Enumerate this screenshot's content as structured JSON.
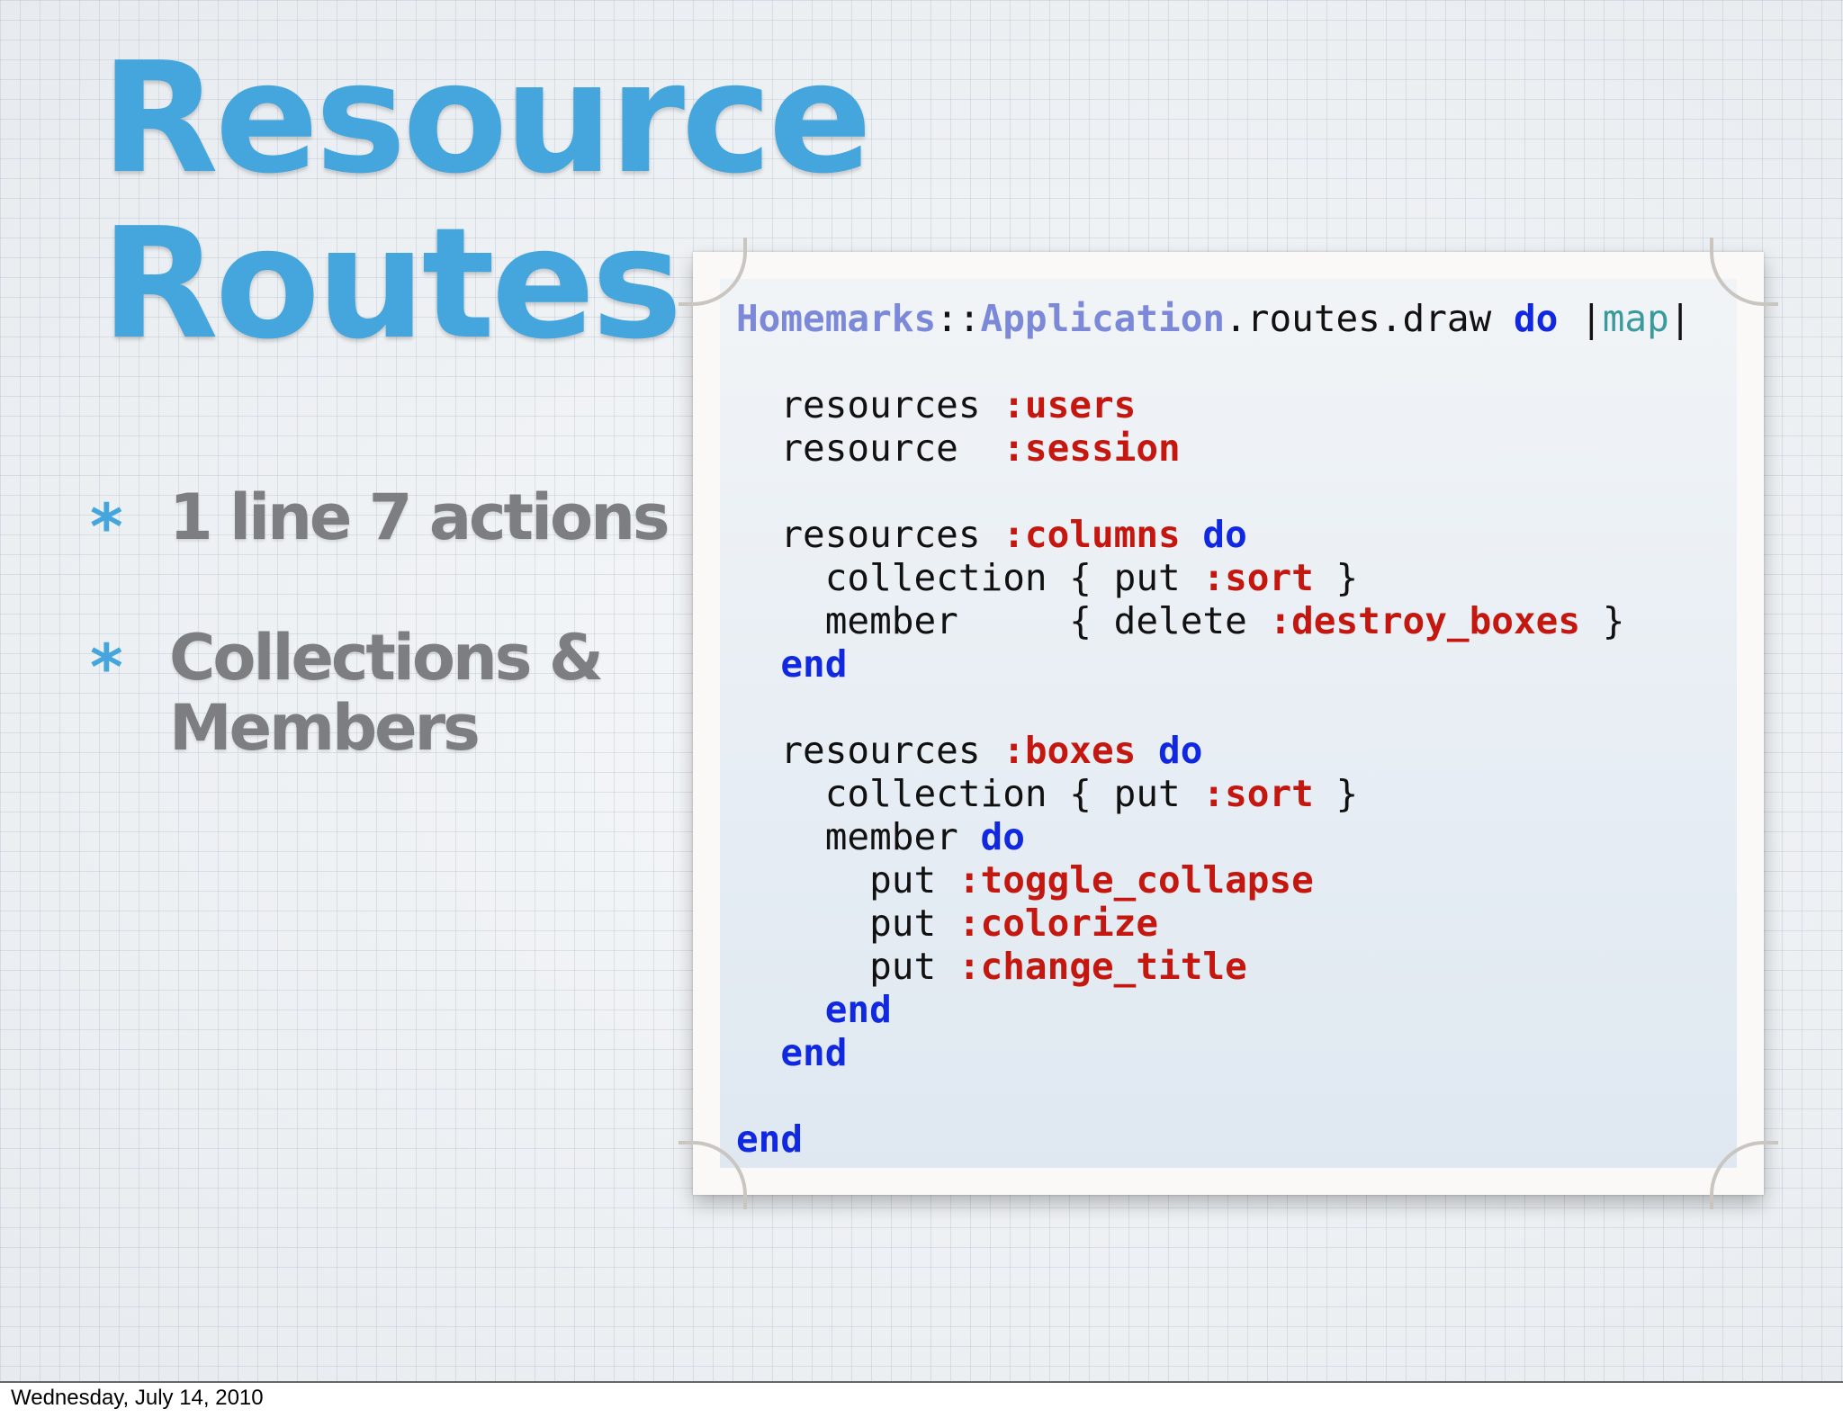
{
  "slide": {
    "title_lines": [
      "Resource",
      "Routes"
    ],
    "bullets": [
      {
        "marker": "*",
        "lines": [
          "1 line 7 actions"
        ]
      },
      {
        "marker": "*",
        "lines": [
          "Collections &",
          "Members"
        ]
      }
    ],
    "code": {
      "lines": [
        {
          "indent": 0,
          "tokens": [
            {
              "t": "class",
              "v": "Homemarks"
            },
            {
              "t": "plain",
              "v": "::"
            },
            {
              "t": "class",
              "v": "Application"
            },
            {
              "t": "plain",
              "v": ".routes.draw "
            },
            {
              "t": "kw",
              "v": "do"
            },
            {
              "t": "plain",
              "v": " |"
            },
            {
              "t": "var",
              "v": "map"
            },
            {
              "t": "plain",
              "v": "|"
            }
          ]
        },
        {
          "indent": 0,
          "tokens": []
        },
        {
          "indent": 1,
          "tokens": [
            {
              "t": "plain",
              "v": "resources "
            },
            {
              "t": "sym",
              "v": ":users"
            }
          ]
        },
        {
          "indent": 1,
          "tokens": [
            {
              "t": "plain",
              "v": "resource  "
            },
            {
              "t": "sym",
              "v": ":session"
            }
          ]
        },
        {
          "indent": 0,
          "tokens": []
        },
        {
          "indent": 1,
          "tokens": [
            {
              "t": "plain",
              "v": "resources "
            },
            {
              "t": "sym",
              "v": ":columns"
            },
            {
              "t": "plain",
              "v": " "
            },
            {
              "t": "kw",
              "v": "do"
            }
          ]
        },
        {
          "indent": 2,
          "tokens": [
            {
              "t": "plain",
              "v": "collection { put "
            },
            {
              "t": "sym",
              "v": ":sort"
            },
            {
              "t": "plain",
              "v": " }"
            }
          ]
        },
        {
          "indent": 2,
          "tokens": [
            {
              "t": "plain",
              "v": "member     { delete "
            },
            {
              "t": "sym",
              "v": ":destroy_boxes"
            },
            {
              "t": "plain",
              "v": " }"
            }
          ]
        },
        {
          "indent": 1,
          "tokens": [
            {
              "t": "kw",
              "v": "end"
            }
          ]
        },
        {
          "indent": 0,
          "tokens": []
        },
        {
          "indent": 1,
          "tokens": [
            {
              "t": "plain",
              "v": "resources "
            },
            {
              "t": "sym",
              "v": ":boxes"
            },
            {
              "t": "plain",
              "v": " "
            },
            {
              "t": "kw",
              "v": "do"
            }
          ]
        },
        {
          "indent": 2,
          "tokens": [
            {
              "t": "plain",
              "v": "collection { put "
            },
            {
              "t": "sym",
              "v": ":sort"
            },
            {
              "t": "plain",
              "v": " }"
            }
          ]
        },
        {
          "indent": 2,
          "tokens": [
            {
              "t": "plain",
              "v": "member "
            },
            {
              "t": "kw",
              "v": "do"
            }
          ]
        },
        {
          "indent": 3,
          "tokens": [
            {
              "t": "plain",
              "v": "put "
            },
            {
              "t": "sym",
              "v": ":toggle_collapse"
            }
          ]
        },
        {
          "indent": 3,
          "tokens": [
            {
              "t": "plain",
              "v": "put "
            },
            {
              "t": "sym",
              "v": ":colorize"
            }
          ]
        },
        {
          "indent": 3,
          "tokens": [
            {
              "t": "plain",
              "v": "put "
            },
            {
              "t": "sym",
              "v": ":change_title"
            }
          ]
        },
        {
          "indent": 2,
          "tokens": [
            {
              "t": "kw",
              "v": "end"
            }
          ]
        },
        {
          "indent": 1,
          "tokens": [
            {
              "t": "kw",
              "v": "end"
            }
          ]
        },
        {
          "indent": 0,
          "tokens": []
        },
        {
          "indent": 0,
          "tokens": [
            {
              "t": "kw",
              "v": "end"
            }
          ]
        }
      ]
    }
  },
  "footer": {
    "date": "Wednesday, July 14, 2010"
  },
  "colors": {
    "title": "#44a6dc",
    "bullet_text": "#7c7e81",
    "code_class": "#7c89d8",
    "code_keyword": "#1028e0",
    "code_symbol": "#c4170f",
    "code_block_var": "#3a9a9c"
  }
}
